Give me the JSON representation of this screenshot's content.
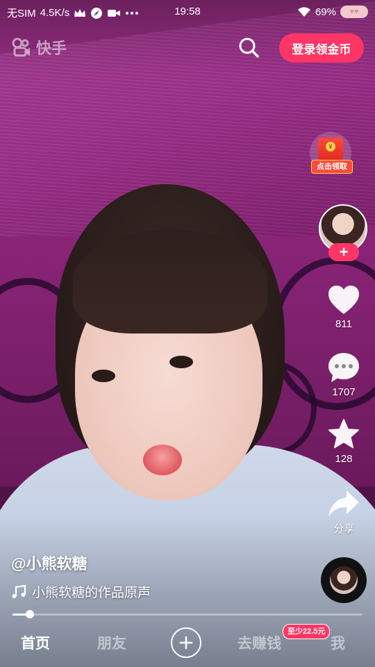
{
  "status_bar": {
    "carrier": "无SIM",
    "net_speed": "4.5K/s",
    "time": "19:58",
    "battery": "69%",
    "icons": [
      "crown-icon",
      "compass-icon",
      "video-camera-icon",
      "more-dots-icon",
      "wifi-icon",
      "battery-icon"
    ]
  },
  "header": {
    "brand": "快手",
    "search_icon": "search-icon",
    "login_label": "登录领金币"
  },
  "redpacket": {
    "label": "点击领取",
    "coin": "¥"
  },
  "author": {
    "follow_label": "+",
    "name": "@小熊软糖",
    "music_text": "小熊软糖的作品原声"
  },
  "actions": {
    "like_count": "811",
    "comment_count": "1707",
    "favorite_count": "128",
    "share_label": "分享"
  },
  "playback": {
    "progress": 0.05
  },
  "bottom_nav": {
    "home": "首页",
    "friends": "朋友",
    "create": "+",
    "earn": "去赚钱",
    "earn_badge": "至少22.5元",
    "me": "我"
  },
  "colors": {
    "accent": "#fe3666",
    "coin": "#ffd24a"
  }
}
